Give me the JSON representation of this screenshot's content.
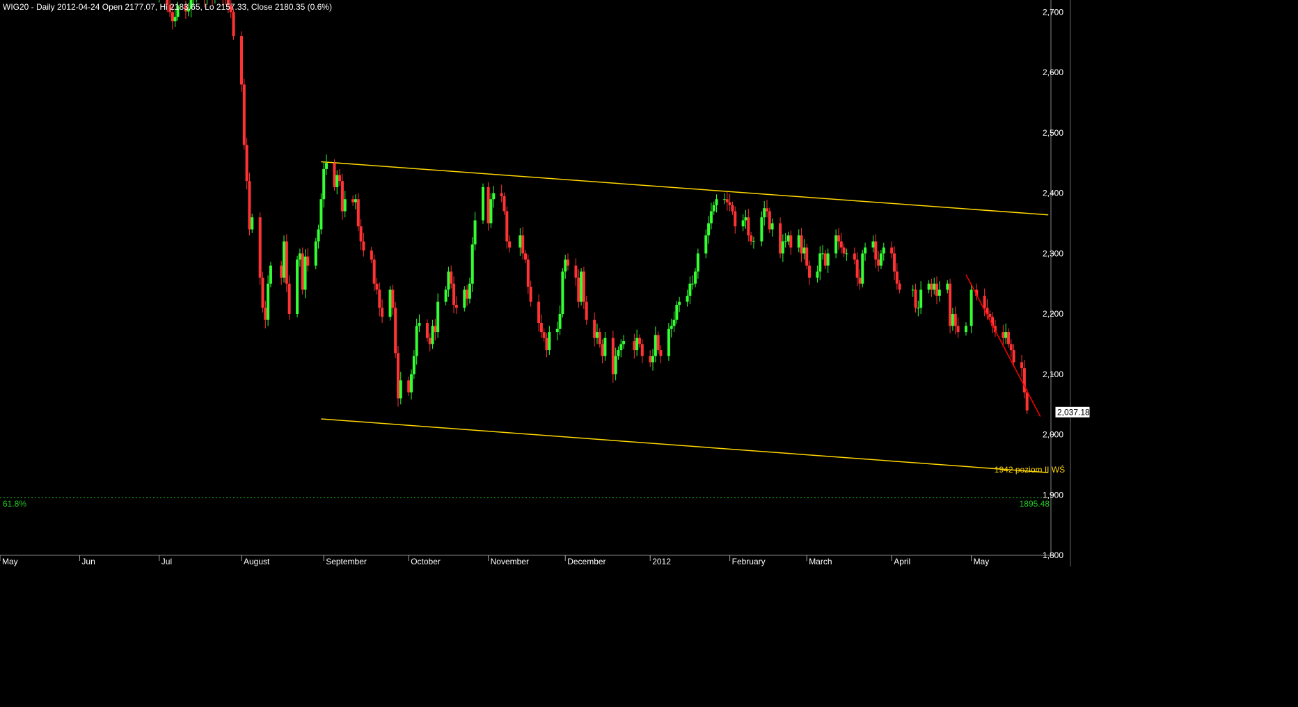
{
  "header": {
    "text": "WIG20 - Daily 2012-04-24 Open 2177.07, Hi 2183.65, Lo 2157.33, Close 2180.35 (0.6%)"
  },
  "colors": {
    "background": "#000000",
    "up_candle": "#33ff33",
    "down_candle": "#ff3333",
    "channel": "#ffd700",
    "trendline": "#ff0000",
    "fib": "#22cc22",
    "axis_text": "#ffffff"
  },
  "chart_data": {
    "type": "candlestick",
    "title": "WIG20 - Daily 2012-04-24 Open 2177.07, Hi 2183.65, Lo 2157.33, Close 2180.35 (0.6%)",
    "ylim": [
      1800,
      2720
    ],
    "y_ticks": [
      {
        "value": 2700,
        "label": "2,700"
      },
      {
        "value": 2600,
        "label": "2,600"
      },
      {
        "value": 2500,
        "label": "2,500"
      },
      {
        "value": 2400,
        "label": "2,400"
      },
      {
        "value": 2300,
        "label": "2,300"
      },
      {
        "value": 2200,
        "label": "2,200"
      },
      {
        "value": 2100,
        "label": "2,100"
      },
      {
        "value": 2000,
        "label": "2,000"
      },
      {
        "value": 1900,
        "label": "1,900"
      },
      {
        "value": 1800,
        "label": "1,800"
      }
    ],
    "x_start": "2011-05-02",
    "x_end": "2012-06-01",
    "x_labels": [
      {
        "date": "2011-05-02",
        "label": "May"
      },
      {
        "date": "2011-06-01",
        "label": "Jun"
      },
      {
        "date": "2011-07-01",
        "label": "Jul"
      },
      {
        "date": "2011-08-01",
        "label": "August"
      },
      {
        "date": "2011-09-01",
        "label": "September"
      },
      {
        "date": "2011-10-03",
        "label": "October"
      },
      {
        "date": "2011-11-02",
        "label": "November"
      },
      {
        "date": "2011-12-01",
        "label": "December"
      },
      {
        "date": "2012-01-02",
        "label": "2012"
      },
      {
        "date": "2012-02-01",
        "label": "February"
      },
      {
        "date": "2012-03-01",
        "label": "March"
      },
      {
        "date": "2012-04-02",
        "label": "April"
      },
      {
        "date": "2012-05-02",
        "label": "May"
      }
    ],
    "price_series": {
      "name": "WIG20",
      "x": [
        "2011-07-01",
        "2011-07-04",
        "2011-07-05",
        "2011-07-06",
        "2011-07-07",
        "2011-07-08",
        "2011-07-11",
        "2011-07-12",
        "2011-07-13",
        "2011-07-14",
        "2011-07-15",
        "2011-07-18",
        "2011-07-19",
        "2011-07-20",
        "2011-07-21",
        "2011-07-22",
        "2011-07-25",
        "2011-07-26",
        "2011-07-27",
        "2011-07-28",
        "2011-07-29",
        "2011-08-01",
        "2011-08-02",
        "2011-08-03",
        "2011-08-04",
        "2011-08-05",
        "2011-08-08",
        "2011-08-09",
        "2011-08-10",
        "2011-08-11",
        "2011-08-12",
        "2011-08-16",
        "2011-08-17",
        "2011-08-18",
        "2011-08-19",
        "2011-08-22",
        "2011-08-23",
        "2011-08-24",
        "2011-08-25",
        "2011-08-26",
        "2011-08-29",
        "2011-08-30",
        "2011-08-31",
        "2011-09-01",
        "2011-09-02",
        "2011-09-05",
        "2011-09-06",
        "2011-09-07",
        "2011-09-08",
        "2011-09-09",
        "2011-09-12",
        "2011-09-13",
        "2011-09-14",
        "2011-09-15",
        "2011-09-16",
        "2011-09-19",
        "2011-09-20",
        "2011-09-21",
        "2011-09-22",
        "2011-09-23",
        "2011-09-26",
        "2011-09-27",
        "2011-09-28",
        "2011-09-29",
        "2011-09-30",
        "2011-10-03",
        "2011-10-04",
        "2011-10-05",
        "2011-10-06",
        "2011-10-07",
        "2011-10-10",
        "2011-10-11",
        "2011-10-12",
        "2011-10-13",
        "2011-10-14",
        "2011-10-17",
        "2011-10-18",
        "2011-10-19",
        "2011-10-20",
        "2011-10-21",
        "2011-10-24",
        "2011-10-25",
        "2011-10-26",
        "2011-10-27",
        "2011-10-28",
        "2011-10-31",
        "2011-11-02",
        "2011-11-03",
        "2011-11-04",
        "2011-11-07",
        "2011-11-08",
        "2011-11-09",
        "2011-11-10",
        "2011-11-14",
        "2011-11-15",
        "2011-11-16",
        "2011-11-17",
        "2011-11-18",
        "2011-11-21",
        "2011-11-22",
        "2011-11-23",
        "2011-11-24",
        "2011-11-25",
        "2011-11-28",
        "2011-11-29",
        "2011-11-30",
        "2011-12-01",
        "2011-12-02",
        "2011-12-05",
        "2011-12-06",
        "2011-12-07",
        "2011-12-08",
        "2011-12-09",
        "2011-12-12",
        "2011-12-13",
        "2011-12-14",
        "2011-12-15",
        "2011-12-16",
        "2011-12-19",
        "2011-12-20",
        "2011-12-21",
        "2011-12-22",
        "2011-12-23",
        "2011-12-27",
        "2011-12-28",
        "2011-12-29",
        "2011-12-30",
        "2012-01-02",
        "2012-01-03",
        "2012-01-04",
        "2012-01-05",
        "2012-01-06",
        "2012-01-09",
        "2012-01-10",
        "2012-01-11",
        "2012-01-12",
        "2012-01-13",
        "2012-01-16",
        "2012-01-17",
        "2012-01-18",
        "2012-01-19",
        "2012-01-20",
        "2012-01-23",
        "2012-01-24",
        "2012-01-25",
        "2012-01-26",
        "2012-01-27",
        "2012-01-30",
        "2012-01-31",
        "2012-02-01",
        "2012-02-02",
        "2012-02-03",
        "2012-02-06",
        "2012-02-07",
        "2012-02-08",
        "2012-02-09",
        "2012-02-10",
        "2012-02-13",
        "2012-02-14",
        "2012-02-15",
        "2012-02-16",
        "2012-02-17",
        "2012-02-20",
        "2012-02-21",
        "2012-02-22",
        "2012-02-23",
        "2012-02-24",
        "2012-02-27",
        "2012-02-28",
        "2012-02-29",
        "2012-03-01",
        "2012-03-02",
        "2012-03-05",
        "2012-03-06",
        "2012-03-07",
        "2012-03-08",
        "2012-03-09",
        "2012-03-12",
        "2012-03-13",
        "2012-03-14",
        "2012-03-15",
        "2012-03-16",
        "2012-03-19",
        "2012-03-20",
        "2012-03-21",
        "2012-03-22",
        "2012-03-23",
        "2012-03-26",
        "2012-03-27",
        "2012-03-28",
        "2012-03-29",
        "2012-03-30",
        "2012-04-02",
        "2012-04-03",
        "2012-04-04",
        "2012-04-05",
        "2012-04-10",
        "2012-04-11",
        "2012-04-12",
        "2012-04-13",
        "2012-04-16",
        "2012-04-17",
        "2012-04-18",
        "2012-04-19",
        "2012-04-20",
        "2012-04-23",
        "2012-04-24",
        "2012-04-25",
        "2012-04-26",
        "2012-04-27",
        "2012-04-30",
        "2012-05-02",
        "2012-05-04",
        "2012-05-07",
        "2012-05-08",
        "2012-05-09",
        "2012-05-10",
        "2012-05-11",
        "2012-05-14",
        "2012-05-15",
        "2012-05-16",
        "2012-05-17",
        "2012-05-18",
        "2012-05-21",
        "2012-05-22",
        "2012-05-23"
      ],
      "close": [
        2722,
        2712,
        2700,
        2685,
        2692,
        2711,
        2701,
        2705,
        2720,
        2722,
        2730,
        2720,
        2740,
        2740,
        2720,
        2725,
        2722,
        2720,
        2712,
        2700,
        2660,
        2580,
        2480,
        2420,
        2340,
        2360,
        2260,
        2210,
        2190,
        2250,
        2280,
        2260,
        2320,
        2250,
        2200,
        2290,
        2300,
        2240,
        2295,
        2280,
        2320,
        2340,
        2390,
        2440,
        2450,
        2410,
        2430,
        2420,
        2370,
        2390,
        2385,
        2390,
        2345,
        2320,
        2305,
        2290,
        2250,
        2240,
        2210,
        2195,
        2240,
        2210,
        2135,
        2060,
        2090,
        2070,
        2100,
        2130,
        2180,
        2185,
        2160,
        2150,
        2180,
        2170,
        2220,
        2240,
        2270,
        2250,
        2215,
        2210,
        2240,
        2225,
        2250,
        2315,
        2355,
        2410,
        2350,
        2390,
        2400,
        2395,
        2370,
        2320,
        2310,
        2330,
        2300,
        2290,
        2245,
        2220,
        2185,
        2170,
        2160,
        2140,
        2170,
        2175,
        2200,
        2270,
        2290,
        2280,
        2260,
        2220,
        2270,
        2220,
        2190,
        2160,
        2170,
        2150,
        2130,
        2160,
        2100,
        2130,
        2140,
        2150,
        2155,
        2140,
        2160,
        2150,
        2130,
        2120,
        2130,
        2165,
        2140,
        2130,
        2175,
        2180,
        2190,
        2215,
        2220,
        2230,
        2250,
        2250,
        2270,
        2300,
        2330,
        2350,
        2370,
        2380,
        2390,
        2390,
        2385,
        2380,
        2370,
        2345,
        2355,
        2360,
        2330,
        2320,
        2320,
        2360,
        2375,
        2370,
        2340,
        2350,
        2300,
        2320,
        2320,
        2330,
        2310,
        2330,
        2300,
        2310,
        2280,
        2260,
        2270,
        2300,
        2300,
        2280,
        2300,
        2330,
        2320,
        2310,
        2300,
        2300,
        2290,
        2260,
        2250,
        2300,
        2310,
        2320,
        2290,
        2280,
        2300,
        2310,
        2300,
        2270,
        2250,
        2240,
        2240,
        2210,
        2210,
        2240,
        2250,
        2240,
        2250,
        2230,
        2240,
        2250,
        2180,
        2200,
        2180,
        2170,
        2180,
        2240,
        2230,
        2210,
        2200,
        2195,
        2180,
        2170,
        2160,
        2170,
        2150,
        2140,
        2120,
        2110,
        2070,
        2040,
        2080,
        2100,
        2070,
        2050,
        2040
      ]
    },
    "channel_upper": {
      "name": "upper channel line",
      "x": [
        "2011-08-31",
        "2012-05-31"
      ],
      "y": [
        2452,
        2364
      ]
    },
    "channel_lower": {
      "name": "lower channel line",
      "x": [
        "2011-08-31",
        "2012-05-31"
      ],
      "y": [
        2026,
        1937
      ]
    },
    "trendline": {
      "name": "downtrend",
      "x": [
        "2012-04-30",
        "2012-05-28"
      ],
      "y": [
        2265,
        2030
      ]
    },
    "fib_level": {
      "label": "61.8%",
      "value": 1895.48,
      "value_label": "1895.48"
    },
    "annotation": {
      "text": "1942 poziom II WŚ",
      "x": "2012-05-24",
      "y": 1942
    },
    "last_price": {
      "value": 2037.18,
      "label": "2,037.18"
    }
  }
}
